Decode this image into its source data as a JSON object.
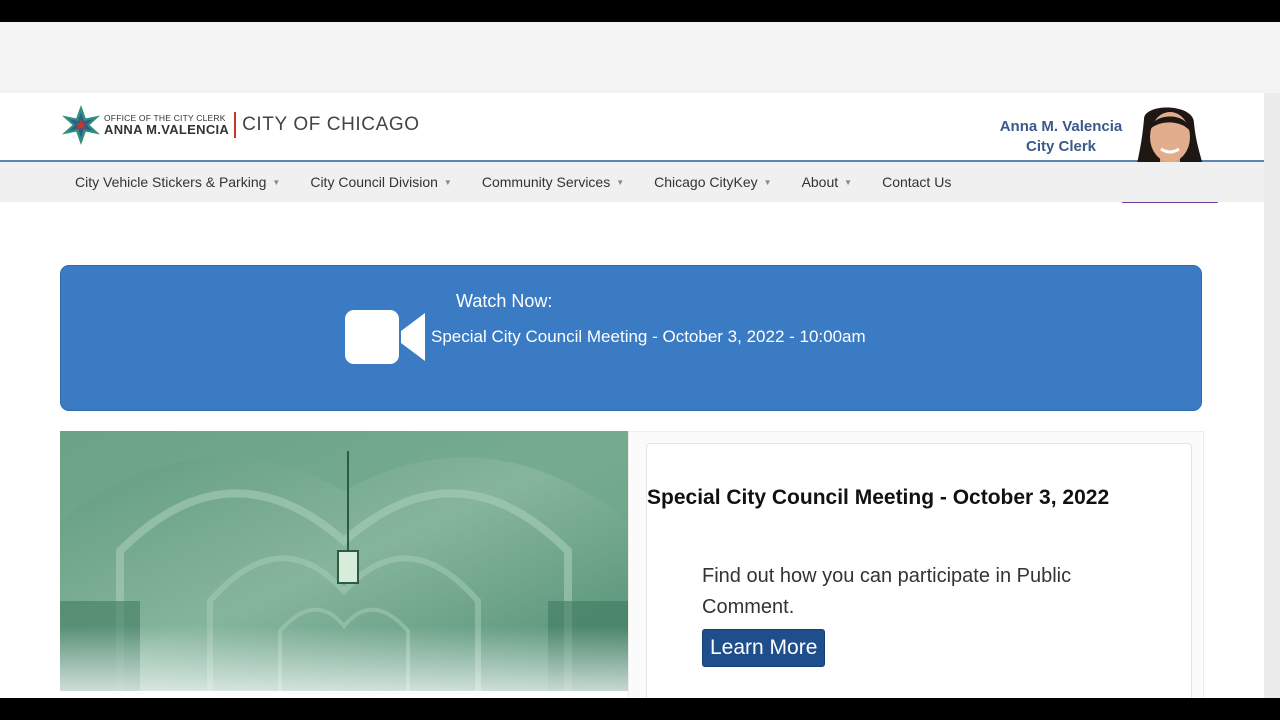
{
  "header": {
    "office_line": "OFFICE OF THE CITY CLERK",
    "name_line": "ANNA M.VALENCIA",
    "city": "CITY OF CHICAGO",
    "clerk_name": "Anna M. Valencia",
    "clerk_title": "City Clerk"
  },
  "nav": {
    "items": [
      {
        "label": "City Vehicle Stickers & Parking",
        "dropdown": true
      },
      {
        "label": "City Council Division",
        "dropdown": true
      },
      {
        "label": "Community Services",
        "dropdown": true
      },
      {
        "label": "Chicago CityKey",
        "dropdown": true
      },
      {
        "label": "About",
        "dropdown": true
      },
      {
        "label": "Contact Us",
        "dropdown": false
      }
    ]
  },
  "banner": {
    "watch_label": "Watch Now:",
    "meeting_text": "Special City Council Meeting - October 3, 2022 - 10:00am",
    "icon": "video-camera-icon",
    "color": "#3a7bc4"
  },
  "card": {
    "title": "Special City Council Meeting -  October 3, 2022",
    "body": "Find out how you can participate in Public Comment.",
    "button_label": "Learn More"
  },
  "colors": {
    "accent": "#3a7bc4",
    "button": "#1f4e8c",
    "header_text": "#3a5a8a"
  }
}
